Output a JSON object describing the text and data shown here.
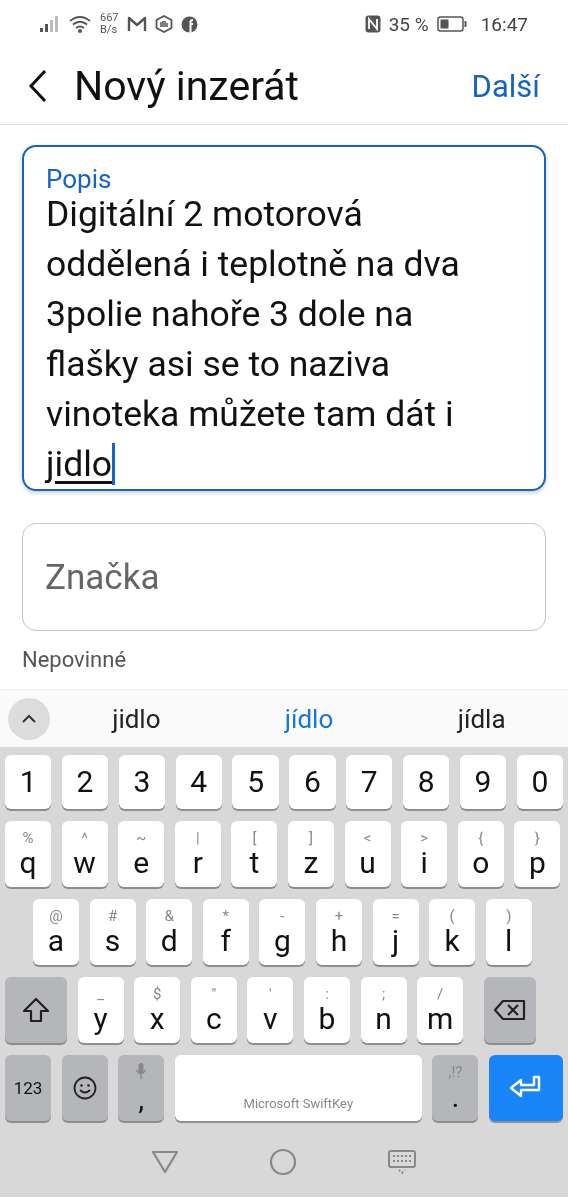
{
  "status_bar": {
    "speed_value": "667",
    "speed_unit": "B/s",
    "battery": "35 %",
    "time": "16:47"
  },
  "header": {
    "title": "Nový inzerát",
    "action": "Další"
  },
  "fields": [
    {
      "label": "Popis",
      "value": "Digitální 2 motorová oddělená i teplotně na dva 3polie nahoře 3 dole na flašky asi se to naziva vinoteka můžete tam dát i",
      "composing": "jidlo",
      "focused": true
    },
    {
      "placeholder": "Značka",
      "helper": "Nepovinné",
      "focused": false
    }
  ],
  "suggestions": [
    {
      "text": "jidlo",
      "selected": false
    },
    {
      "text": "jídlo",
      "selected": true
    },
    {
      "text": "jídla",
      "selected": false
    }
  ],
  "keyboard": {
    "rows": [
      {
        "keys": [
          {
            "kind": "char",
            "main": "1"
          },
          {
            "kind": "char",
            "main": "2"
          },
          {
            "kind": "char",
            "main": "3"
          },
          {
            "kind": "char",
            "main": "4"
          },
          {
            "kind": "char",
            "main": "5"
          },
          {
            "kind": "char",
            "main": "6"
          },
          {
            "kind": "char",
            "main": "7"
          },
          {
            "kind": "char",
            "main": "8"
          },
          {
            "kind": "char",
            "main": "9"
          },
          {
            "kind": "char",
            "main": "0"
          }
        ]
      },
      {
        "keys": [
          {
            "kind": "char",
            "main": "q",
            "alt": "%"
          },
          {
            "kind": "char",
            "main": "w",
            "alt": "^"
          },
          {
            "kind": "char",
            "main": "e",
            "alt": "~"
          },
          {
            "kind": "char",
            "main": "r",
            "alt": "|"
          },
          {
            "kind": "char",
            "main": "t",
            "alt": "["
          },
          {
            "kind": "char",
            "main": "z",
            "alt": "]"
          },
          {
            "kind": "char",
            "main": "u",
            "alt": "<"
          },
          {
            "kind": "char",
            "main": "i",
            "alt": ">"
          },
          {
            "kind": "char",
            "main": "o",
            "alt": "{"
          },
          {
            "kind": "char",
            "main": "p",
            "alt": "}"
          }
        ]
      },
      {
        "keys": [
          {
            "kind": "char",
            "main": "a",
            "alt": "@"
          },
          {
            "kind": "char",
            "main": "s",
            "alt": "#"
          },
          {
            "kind": "char",
            "main": "d",
            "alt": "&"
          },
          {
            "kind": "char",
            "main": "f",
            "alt": "*"
          },
          {
            "kind": "char",
            "main": "g",
            "alt": "-"
          },
          {
            "kind": "char",
            "main": "h",
            "alt": "+"
          },
          {
            "kind": "char",
            "main": "j",
            "alt": "="
          },
          {
            "kind": "char",
            "main": "k",
            "alt": "("
          },
          {
            "kind": "char",
            "main": "l",
            "alt": ")"
          }
        ]
      },
      {
        "keys": [
          {
            "kind": "shift"
          },
          {
            "kind": "char",
            "main": "y",
            "alt": "_"
          },
          {
            "kind": "char",
            "main": "x",
            "alt": "$"
          },
          {
            "kind": "char",
            "main": "c",
            "alt": "\""
          },
          {
            "kind": "char",
            "main": "v",
            "alt": "'"
          },
          {
            "kind": "char",
            "main": "b",
            "alt": ":"
          },
          {
            "kind": "char",
            "main": "n",
            "alt": ";"
          },
          {
            "kind": "char",
            "main": "m",
            "alt": "/"
          },
          {
            "kind": "backspace"
          }
        ]
      },
      {
        "keys": [
          {
            "kind": "symbols",
            "label": "123"
          },
          {
            "kind": "emoji"
          },
          {
            "kind": "comma",
            "main": ","
          },
          {
            "kind": "space",
            "label": "Microsoft SwiftKey"
          },
          {
            "kind": "period",
            "main": ".",
            "alt": ",!?"
          },
          {
            "kind": "enter"
          }
        ]
      }
    ]
  }
}
